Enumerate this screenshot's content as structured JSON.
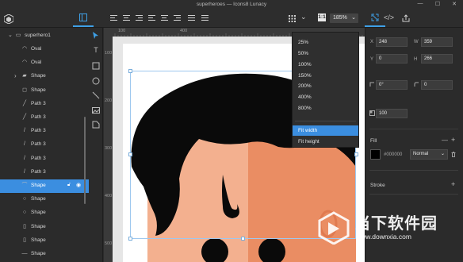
{
  "window": {
    "title": "superheroes — Icons8 Lunacy",
    "minimize": "—",
    "maximize": "☐",
    "close": "✕"
  },
  "toolbar": {
    "zoom_value": "185%",
    "one_to_one": "1:1",
    "grid_icon": "grid-icon",
    "chevron": "⌄"
  },
  "layers": {
    "root_label": "superhero1",
    "items": [
      {
        "label": "Oval",
        "icon": "oval-icon",
        "glyph": "◠"
      },
      {
        "label": "Oval",
        "icon": "oval-icon",
        "glyph": "◠"
      },
      {
        "label": "Shape",
        "icon": "folder-shape-icon",
        "glyph": "▰"
      },
      {
        "label": "Shape",
        "icon": "shape-icon",
        "glyph": "◻"
      },
      {
        "label": "Path 3",
        "icon": "path-icon",
        "glyph": "╱"
      },
      {
        "label": "Path 3",
        "icon": "path-icon",
        "glyph": "╱"
      },
      {
        "label": "Path 3",
        "icon": "path-icon",
        "glyph": "/"
      },
      {
        "label": "Path 3",
        "icon": "path-icon",
        "glyph": "/"
      },
      {
        "label": "Path 3",
        "icon": "path-icon",
        "glyph": "/"
      },
      {
        "label": "Path 3",
        "icon": "path-icon",
        "glyph": "/"
      },
      {
        "label": "Shape",
        "icon": "shape-icon",
        "glyph": "⌒",
        "selected": true
      },
      {
        "label": "Shape",
        "icon": "shape-icon",
        "glyph": "○"
      },
      {
        "label": "Shape",
        "icon": "shape-icon",
        "glyph": "○"
      },
      {
        "label": "Shape",
        "icon": "shape-icon",
        "glyph": "▯"
      },
      {
        "label": "Shape",
        "icon": "shape-icon",
        "glyph": "▯"
      },
      {
        "label": "Shape",
        "icon": "shape-icon",
        "glyph": "—"
      }
    ]
  },
  "rulers": {
    "top": [
      "100",
      "",
      "400"
    ],
    "left": [
      "100",
      "200",
      "300",
      "400",
      "500"
    ]
  },
  "zoom_menu": {
    "options": [
      "25%",
      "50%",
      "100%",
      "150%",
      "200%",
      "400%",
      "800%"
    ],
    "fit_width": "Fit width",
    "fit_height": "Fit height",
    "highlighted": "Fit width"
  },
  "inspector": {
    "x_label": "X",
    "x_value": "248",
    "w_label": "W",
    "w_value": "359",
    "y_label": "Y",
    "y_value": "0",
    "h_label": "H",
    "h_value": "266",
    "rotation": "0°",
    "radius": "0",
    "opacity": "100",
    "fill_title": "Fill",
    "fill_hex": "#000000",
    "blend_mode": "Normal",
    "stroke_title": "Stroke"
  },
  "watermark": {
    "brand": "当下软件园",
    "url": "www.downxia.com"
  },
  "colors": {
    "accent": "#3b8ee0",
    "hair": "#0a0a0a",
    "skin_light": "#f3b08f",
    "skin_dark": "#ea8d63",
    "panel": "#2b2b2b"
  }
}
